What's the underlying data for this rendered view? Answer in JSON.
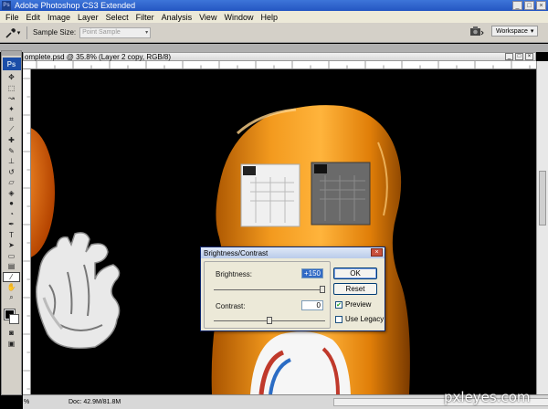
{
  "app": {
    "title": "Adobe Photoshop CS3 Extended",
    "logo": "Ps",
    "minimize": "_",
    "maximize": "□",
    "close": "×"
  },
  "menu": [
    "File",
    "Edit",
    "Image",
    "Layer",
    "Select",
    "Filter",
    "Analysis",
    "View",
    "Window",
    "Help"
  ],
  "options": {
    "arrow": "▾",
    "sample_size_label": "Sample Size:",
    "sample_size_value": "Point Sample",
    "workspace_label": "Workspace",
    "workspace_arrow": "▾"
  },
  "document": {
    "title": "omplete.psd @ 35.8% (Layer 2 copy, RGB/8)",
    "zoom": "%",
    "doc_size": "Doc: 42.9M/81.8M"
  },
  "dialog": {
    "title": "Brightness/Contrast",
    "close": "×",
    "brightness_label": "Brightness:",
    "brightness_value": "+150",
    "brightness_level": 1.0,
    "contrast_label": "Contrast:",
    "contrast_value": "0",
    "contrast_level": 0.5,
    "ok_label": "OK",
    "reset_label": "Reset",
    "preview_label": "Preview",
    "preview_checked": true,
    "use_legacy_label": "Use Legacy",
    "use_legacy_checked": false
  },
  "watermark": "pxleyes.com",
  "colors": {
    "orange": "#e8860f",
    "accent": "#316ac5"
  },
  "icons": [
    "eyedropper-icon",
    "move-icon",
    "marquee-icon",
    "lasso-icon",
    "magic-wand-icon",
    "crop-icon",
    "slice-icon",
    "healing-brush-icon",
    "brush-icon",
    "clone-stamp-icon",
    "history-brush-icon",
    "eraser-icon",
    "paint-bucket-icon",
    "blur-icon",
    "dodge-icon",
    "pen-icon",
    "type-icon",
    "path-selection-icon",
    "rectangle-icon",
    "notes-icon",
    "hand-icon",
    "zoom-icon"
  ]
}
